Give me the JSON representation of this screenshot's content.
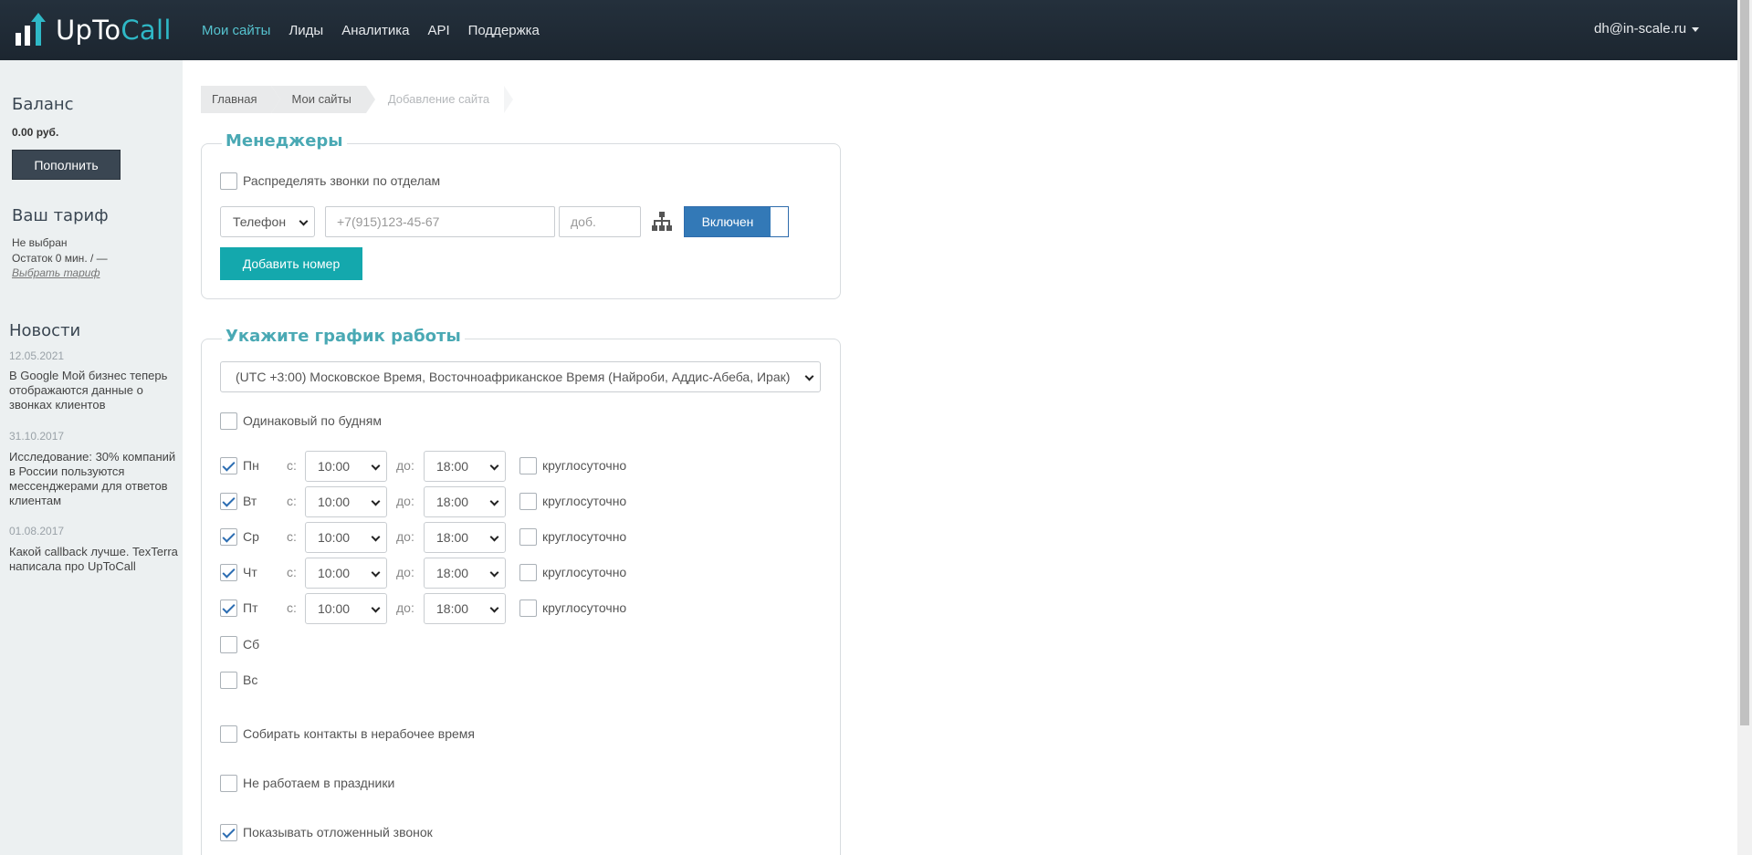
{
  "header": {
    "logo_part1": "UpTo",
    "logo_part2": "Call",
    "nav": [
      "Мои сайты",
      "Лиды",
      "Аналитика",
      "API",
      "Поддержка"
    ],
    "user_email": "dh@in-scale.ru",
    "accent_color": "#56c3cf"
  },
  "sidebar": {
    "balance_title": "Баланс",
    "balance_value": "0.00 руб.",
    "topup_label": "Пополнить",
    "tariff_title": "Ваш тариф",
    "tariff_status": "Не выбран",
    "tariff_remaining": "Остаток 0 мин. / —",
    "tariff_link": "Выбрать тариф",
    "news_title": "Новости",
    "news": [
      {
        "date": "12.05.2021",
        "text": "В Google Мой бизнес теперь отображаются данные о звонках клиентов"
      },
      {
        "date": "31.10.2017",
        "text": "Исследование: 30% компаний в России пользуются мессенджерами для ответов клиентам"
      },
      {
        "date": "01.08.2017",
        "text": "Какой callback лучше. TexTerra написала про UpToCall"
      }
    ]
  },
  "breadcrumb": [
    "Главная",
    "Мои сайты",
    "Добавление сайта"
  ],
  "managers": {
    "title": "Менеджеры",
    "distribute_label": "Распределять звонки по отделам",
    "type_value": "Телефон",
    "phone_placeholder": "+7(915)123-45-67",
    "ext_placeholder": "доб.",
    "toggle_label": "Включен",
    "add_button": "Добавить номер"
  },
  "schedule": {
    "title": "Укажите график работы",
    "timezone": "(UTC +3:00) Московское Время, Восточноафриканское Время (Найроби, Аддис-Абеба, Ирак)",
    "same_weekdays_label": "Одинаковый по будням",
    "from_label": "с:",
    "to_label": "до:",
    "allday_label": "круглосуточно",
    "days": [
      {
        "name": "Пн",
        "checked": true,
        "from": "10:00",
        "to": "18:00"
      },
      {
        "name": "Вт",
        "checked": true,
        "from": "10:00",
        "to": "18:00"
      },
      {
        "name": "Ср",
        "checked": true,
        "from": "10:00",
        "to": "18:00"
      },
      {
        "name": "Чт",
        "checked": true,
        "from": "10:00",
        "to": "18:00"
      },
      {
        "name": "Пт",
        "checked": true,
        "from": "10:00",
        "to": "18:00"
      },
      {
        "name": "Сб",
        "checked": false
      },
      {
        "name": "Вс",
        "checked": false
      }
    ],
    "collect_contacts_label": "Собирать контакты в нерабочее время",
    "no_holidays_label": "Не работаем в праздники",
    "show_delayed_label": "Показывать отложенный звонок",
    "show_delayed_checked": true
  }
}
